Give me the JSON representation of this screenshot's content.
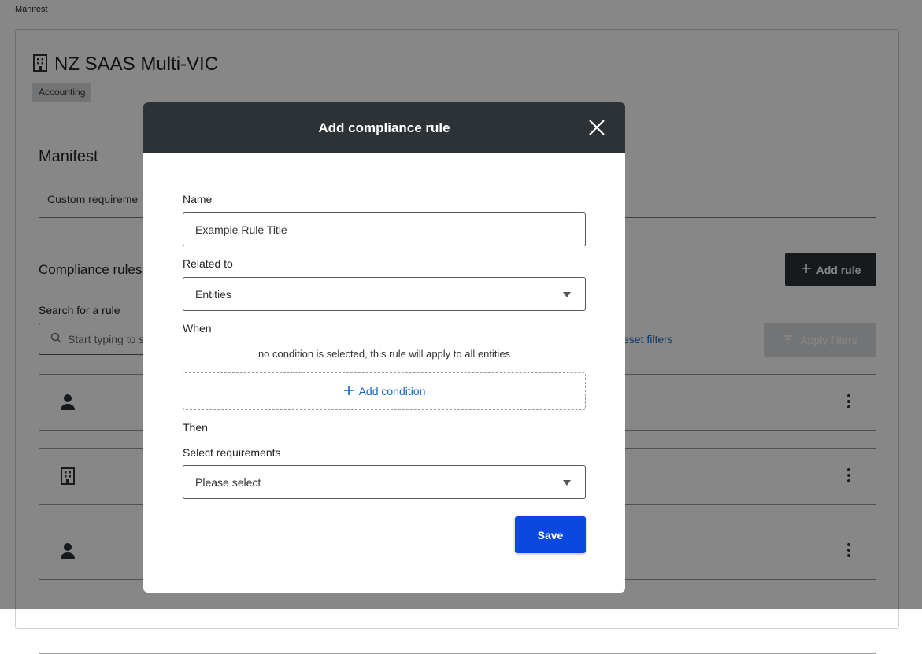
{
  "breadcrumb": "Manifest",
  "header": {
    "title": "NZ SAAS Multi-VIC",
    "tag": "Accounting"
  },
  "section": {
    "title": "Manifest",
    "tab_label": "Custom requireme"
  },
  "rules": {
    "title": "Compliance rules",
    "add_rule_label": "Add rule",
    "search_label": "Search for a rule",
    "search_placeholder": "Start typing to s",
    "reset_label": "eset filters",
    "apply_label": "Apply filters",
    "rows": [
      {
        "icon": "person-icon"
      },
      {
        "icon": "building-icon"
      },
      {
        "icon": "person-icon"
      }
    ]
  },
  "modal": {
    "title": "Add compliance rule",
    "name_label": "Name",
    "name_value": "Example Rule Title",
    "related_label": "Related to",
    "related_value": "Entities",
    "when_label": "When",
    "when_note": "no condition is selected, this rule will apply to all entities",
    "add_condition_label": "Add condition",
    "then_label": "Then",
    "requirements_label": "Select requirements",
    "requirements_placeholder": "Please select",
    "save_label": "Save"
  },
  "colors": {
    "dark": "#2c3235",
    "primary": "#0a48e0",
    "link": "#1565c0"
  }
}
